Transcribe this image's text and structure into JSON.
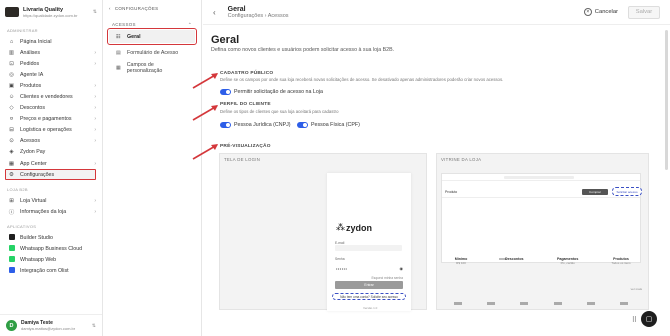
{
  "brand": {
    "name": "Livraria Quality",
    "url": "https://qualidade.zydon.com.br"
  },
  "sidebar": {
    "section_admin": "ADMINISTRAR",
    "items": [
      {
        "icon": "home",
        "label": "Página Inicial",
        "chev": ""
      },
      {
        "icon": "chart",
        "label": "Análises",
        "chev": "›"
      },
      {
        "icon": "cart",
        "label": "Pedidos",
        "chev": "›"
      },
      {
        "icon": "ai",
        "label": "Agente IA",
        "chev": ""
      },
      {
        "icon": "box",
        "label": "Produtos",
        "chev": "›"
      },
      {
        "icon": "users",
        "label": "Clientes e vendedores",
        "chev": "›"
      },
      {
        "icon": "tag",
        "label": "Descontos",
        "chev": "›"
      },
      {
        "icon": "price",
        "label": "Preços e pagamentos",
        "chev": "›"
      },
      {
        "icon": "truck",
        "label": "Logística e operações",
        "chev": "›"
      },
      {
        "icon": "lock",
        "label": "Acessos",
        "chev": "›"
      },
      {
        "icon": "pay",
        "label": "Zydon Pay",
        "chev": ""
      },
      {
        "icon": "app",
        "label": "App Center",
        "chev": "›"
      },
      {
        "icon": "gear",
        "label": "Configurações",
        "chev": ""
      }
    ],
    "section_b2b": "LOJA B2B",
    "b2b_items": [
      {
        "label": "Loja Virtual",
        "chev": "›"
      },
      {
        "label": "Informações da loja",
        "chev": "›"
      }
    ],
    "section_apps": "APLICATIVOS",
    "apps": [
      {
        "label": "Builder Studio",
        "color": "#1f1f1f"
      },
      {
        "label": "Whatsapp Business Cloud",
        "color": "#25d366"
      },
      {
        "label": "Whatsapp Web",
        "color": "#25d366"
      },
      {
        "label": "Integração com Olist",
        "color": "#2d5ee8"
      }
    ],
    "user": {
      "initial": "D",
      "name": "Damiya Teste",
      "email": "damiya.mattos@zydon.com.br"
    }
  },
  "col2": {
    "header": "CONFIGURAÇÕES",
    "section": "ACESSOS",
    "items": [
      "Geral",
      "Formulário de Acesso",
      "Campos de personalização"
    ]
  },
  "topbar": {
    "title": "Geral",
    "breadcrumb_a": "Configurações",
    "breadcrumb_sep": "›",
    "breadcrumb_b": "Acessos",
    "cancel": "Cancelar",
    "save": "Salvar"
  },
  "main": {
    "title": "Geral",
    "subtitle": "Defina como novos clientes e usuários podem solicitar acesso à sua loja B2B.",
    "cad_title": "CADASTRO PÚBLICO",
    "cad_desc": "Define se os campos por onde sua loja receberá novas solicitações de acesso. Se desativado apenas administradores poderão criar novos acessos.",
    "toggle1": "Permitir solicitação de acesso na Loja",
    "perfil_title": "PERFIL DO CLIENTE",
    "perfil_desc": "Define os tipos de clientes que sua loja aceitará para cadastro",
    "toggle2": "Pessoa Jurídica (CNPJ)",
    "toggle3": "Pessoa Física (CPF)",
    "preview_title": "PRÉ-VISUALIZAÇÃO",
    "login_label": "TELA DE LOGIN",
    "store_label": "VITRINE DA LOJA"
  },
  "login_card": {
    "logo": "zydon",
    "email_label": "E-mail",
    "pass_label": "Senha",
    "dots": "••••••",
    "forgot": "Esqueci minha senha",
    "button": "Entrar",
    "ask": "Não tem uma conta? Solicite seu acesso",
    "version": "Versão 1.0"
  },
  "store": {
    "product": "Produto",
    "btn_buy": "Comprar",
    "btn_req": "Solicitar acesso",
    "feat": [
      {
        "t": "Mínimo",
        "s": "R$ 100"
      },
      {
        "t": "Descontos",
        "s": ""
      },
      {
        "t": "Pagamentos",
        "s": "Pix, cartão"
      },
      {
        "t": "Produtos",
        "s": "Todos os itens"
      }
    ],
    "see_more": "ver mais"
  }
}
